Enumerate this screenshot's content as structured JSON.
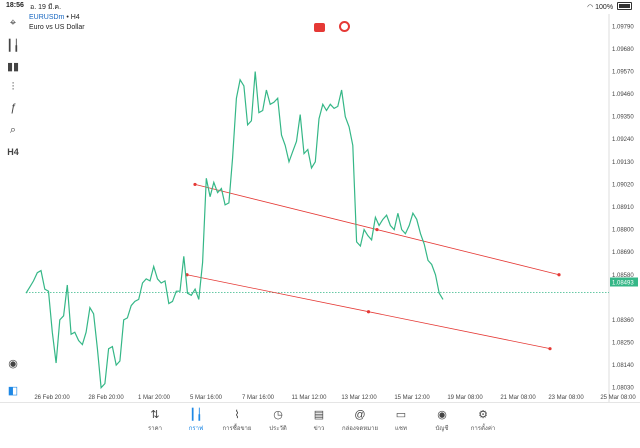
{
  "status_bar": {
    "time": "18:56",
    "date": "อ. 19 มี.ค.",
    "battery": "100%"
  },
  "symbol": {
    "name": "EURUSDm",
    "timeframe": " • H4",
    "description": "Euro vs US Dollar"
  },
  "toolbar": {
    "timeframe_label": "H4"
  },
  "chart": {
    "price_labels": [
      "1.09790",
      "1.09680",
      "1.09570",
      "1.09460",
      "1.09350",
      "1.09240",
      "1.09130",
      "1.09020",
      "1.08910",
      "1.08800",
      "1.08690",
      "1.08580",
      "1.08360",
      "1.08250",
      "1.08140",
      "1.08030"
    ],
    "current_price": "1.08493",
    "time_labels": [
      "26 Feb 20:00",
      "28 Feb 20:00",
      "1 Mar 20:00",
      "5 Mar 16:00",
      "7 Mar 16:00",
      "11 Mar 12:00",
      "13 Mar 12:00",
      "15 Mar 12:00",
      "19 Mar 08:00",
      "21 Mar 08:00",
      "23 Mar 08:00",
      "25 Mar 08:00"
    ],
    "colors": {
      "line": "#35b787",
      "trendline": "#e53935",
      "current_price": "#35b787"
    }
  },
  "chart_data": {
    "type": "line",
    "title": "EURUSDm • H4",
    "xlabel": "",
    "ylabel": "",
    "ylim": [
      1.0797,
      1.0985
    ],
    "series": [
      {
        "name": "EURUSDm",
        "values": [
          1.0849,
          1.0852,
          1.0855,
          1.0859,
          1.086,
          1.0851,
          1.085,
          1.083,
          1.0815,
          1.0836,
          1.0838,
          1.0853,
          1.0829,
          1.083,
          1.0826,
          1.0824,
          1.083,
          1.0842,
          1.0839,
          1.0822,
          1.0803,
          1.0805,
          1.0822,
          1.0823,
          1.0814,
          1.0816,
          1.0836,
          1.0837,
          1.0843,
          1.0845,
          1.0846,
          1.0854,
          1.0856,
          1.0855,
          1.0862,
          1.0856,
          1.0854,
          1.0855,
          1.0844,
          1.0845,
          1.085,
          1.085,
          1.0867,
          1.0849,
          1.0848,
          1.0851,
          1.0846,
          1.0864,
          1.0905,
          1.0896,
          1.0903,
          1.0898,
          1.09,
          1.0892,
          1.0893,
          1.0915,
          1.0944,
          1.0953,
          1.095,
          1.0931,
          1.0933,
          1.0957,
          1.0937,
          1.0938,
          1.0948,
          1.0941,
          1.0942,
          1.0944,
          1.0926,
          1.0921,
          1.0913,
          1.0918,
          1.0923,
          1.0936,
          1.0917,
          1.0919,
          1.091,
          1.0913,
          1.0934,
          1.0941,
          1.0938,
          1.0941,
          1.0939,
          1.094,
          1.0948,
          1.0935,
          1.093,
          1.0921,
          1.0874,
          1.0872,
          1.088,
          1.0877,
          1.0875,
          1.0886,
          1.0882,
          1.0885,
          1.0887,
          1.0882,
          1.088,
          1.0888,
          1.088,
          1.0878,
          1.0882,
          1.0888,
          1.0885,
          1.0878,
          1.0873,
          1.0865,
          1.0863,
          1.0858,
          1.0849,
          1.0846
        ]
      }
    ],
    "trendlines": [
      {
        "from": {
          "x": "5 Mar 16:00",
          "y": 1.0902
        },
        "to": {
          "x": "23 Mar 08:00",
          "y": 1.0858
        }
      },
      {
        "from": {
          "x": "5 Mar 08:00",
          "y": 1.0858
        },
        "to": {
          "x": "23 Mar 04:00",
          "y": 1.0822
        }
      }
    ]
  },
  "bottom_nav": [
    {
      "label": "ราคา",
      "icon": "quotes-icon"
    },
    {
      "label": "กราฟ",
      "icon": "chart-icon",
      "active": true
    },
    {
      "label": "การซื้อขาย",
      "icon": "trade-icon"
    },
    {
      "label": "ประวัติ",
      "icon": "history-icon"
    },
    {
      "label": "ข่าว",
      "icon": "news-icon"
    },
    {
      "label": "กล่องจดหมาย",
      "icon": "mailbox-icon"
    },
    {
      "label": "แชท",
      "icon": "chat-icon"
    },
    {
      "label": "บัญชี",
      "icon": "account-icon"
    },
    {
      "label": "การตั้งค่า",
      "icon": "settings-icon"
    }
  ]
}
